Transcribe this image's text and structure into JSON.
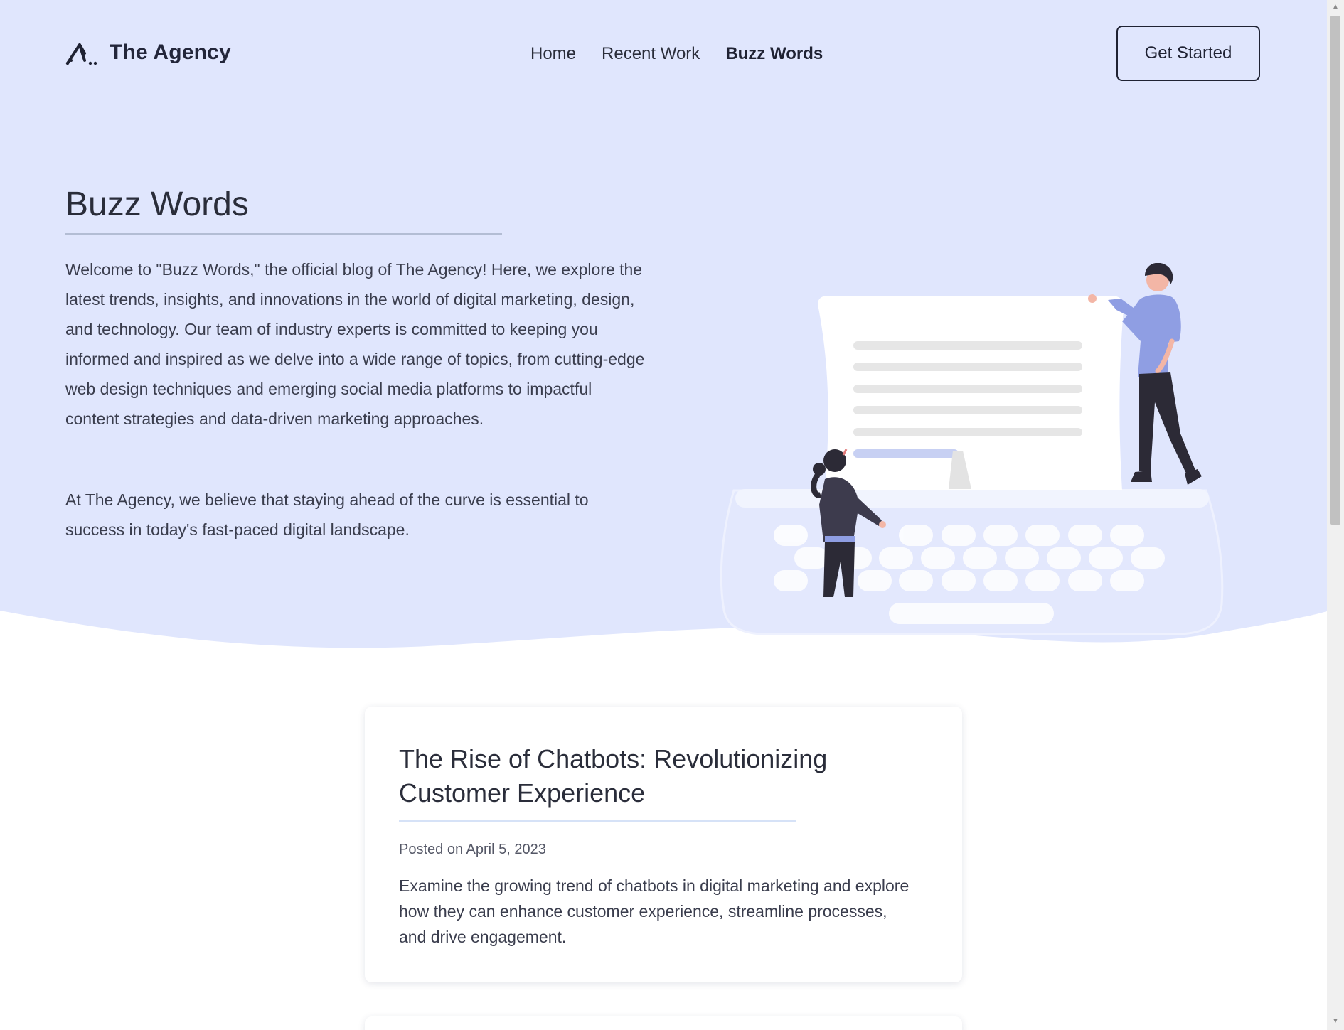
{
  "nav": {
    "brand_name": "The Agency",
    "links": [
      "Home",
      "Recent Work",
      "Buzz Words"
    ],
    "active_link": "Buzz Words",
    "cta_label": "Get Started"
  },
  "hero": {
    "title": "Buzz Words",
    "paragraph_1": "Welcome to \"Buzz Words,\" the official blog of The Agency! Here, we explore the latest trends, insights, and innovations in the world of digital marketing, design, and technology. Our team of industry experts is committed to keeping you informed and inspired as we delve into a wide range of topics, from cutting-edge web design techniques and emerging social media platforms to impactful content strategies and data-driven marketing approaches.",
    "paragraph_2": "At The Agency, we believe that staying ahead of the curve is essential to success in today's fast-paced digital landscape."
  },
  "posts": [
    {
      "title": "The Rise of Chatbots: Revolutionizing Customer Experience",
      "date": "Posted on April 5, 2023",
      "description": "Examine the growing trend of chatbots in digital marketing and explore how they can enhance customer experience, streamline processes, and drive engagement."
    }
  ],
  "colors": {
    "hero_background": "#e0e6fd",
    "accent": "#8f9ee3",
    "text_dark": "#1f2233"
  },
  "icons": {
    "brand_logo": "agency-logo-icon"
  }
}
